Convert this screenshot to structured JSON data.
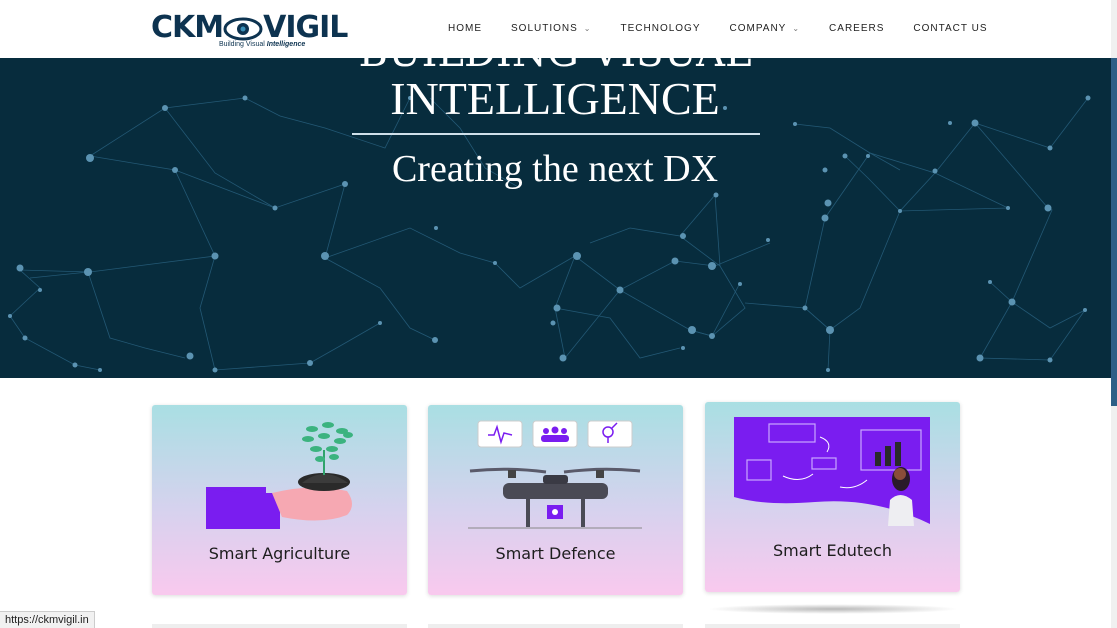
{
  "header": {
    "logo_text_left": "CKM",
    "logo_text_right": "VIGIL",
    "logo_tagline_plain": "Building Visual ",
    "logo_tagline_em": "Intelligence",
    "nav": [
      {
        "label": "HOME",
        "has_dropdown": false
      },
      {
        "label": "SOLUTIONS",
        "has_dropdown": true
      },
      {
        "label": "TECHNOLOGY",
        "has_dropdown": false
      },
      {
        "label": "COMPANY",
        "has_dropdown": true
      },
      {
        "label": "CAREERS",
        "has_dropdown": false
      },
      {
        "label": "CONTACT US",
        "has_dropdown": false
      }
    ]
  },
  "hero": {
    "partial_line": "BUILDING VISUAL",
    "title": "INTELLIGENCE",
    "subtitle": "Creating the next DX"
  },
  "cards": [
    {
      "label": "Smart Agriculture"
    },
    {
      "label": "Smart Defence"
    },
    {
      "label": "Smart Edutech"
    }
  ],
  "status_bar": {
    "url": "https://ckmvigil.in"
  },
  "colors": {
    "brand": "#0d3350",
    "hero_bg": "#072c3d",
    "accent_purple": "#7a1df0"
  }
}
